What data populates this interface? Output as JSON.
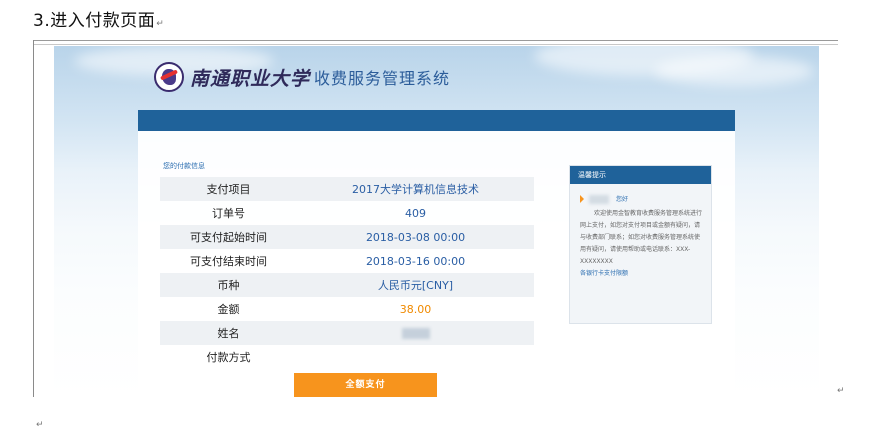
{
  "document": {
    "heading": "3.进入付款页面",
    "paragraph_mark": "↵"
  },
  "header": {
    "school_name": "南通职业大学",
    "system_name": "收费服务管理系统"
  },
  "payment_info": {
    "section_title": "您的付款信息",
    "rows": [
      {
        "label": "支付项目",
        "value": "2017大学计算机信息技术"
      },
      {
        "label": "订单号",
        "value": "409"
      },
      {
        "label": "可支付起始时间",
        "value": "2018-03-08 00:00"
      },
      {
        "label": "可支付结束时间",
        "value": "2018-03-16 00:00"
      },
      {
        "label": "币种",
        "value": "人民币元[CNY]"
      },
      {
        "label": "金额",
        "value": "38.00"
      },
      {
        "label": "姓名",
        "value": ""
      },
      {
        "label": "付款方式",
        "value": ""
      }
    ],
    "pay_button_label": "全额支付"
  },
  "tips": {
    "header": "温馨提示",
    "greeting": "您好",
    "message": "欢迎使用金智教育收费服务管理系统进行网上支付，如您对支付项目或金额有疑问，请与收费部门联系；如您对收费服务管理系统使用有疑问，请使用帮助或电话联系：XXX-XXXXXXXX",
    "link": "各银行卡支付限额"
  },
  "colors": {
    "nav_blue": "#1f629a",
    "value_blue": "#2a5ea4",
    "amount_orange": "#f08a00",
    "button_orange": "#f7941d"
  }
}
